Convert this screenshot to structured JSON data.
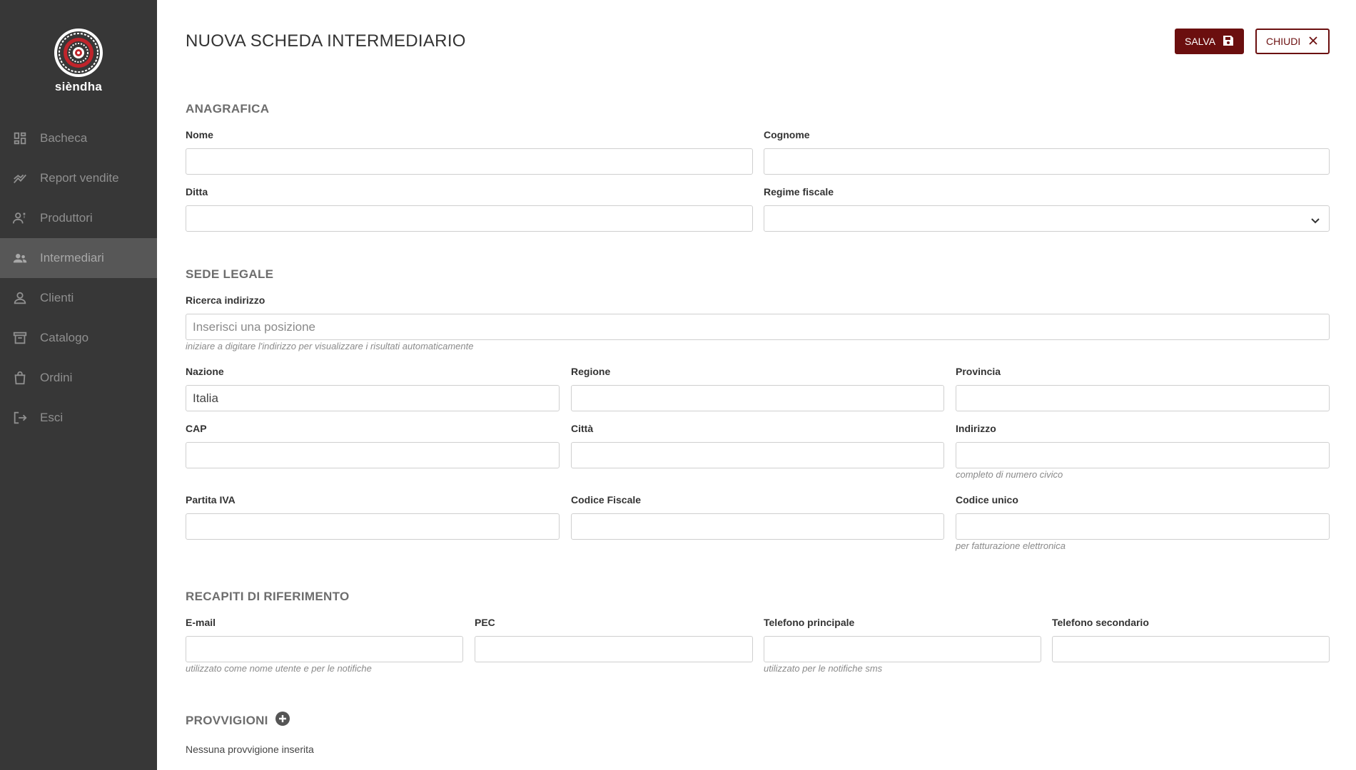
{
  "sidebar": {
    "logo_text": "sièndha",
    "items": [
      {
        "label": "Bacheca",
        "icon": "dashboard-icon",
        "active": false
      },
      {
        "label": "Report vendite",
        "icon": "chart-icon",
        "active": false
      },
      {
        "label": "Produttori",
        "icon": "producers-icon",
        "active": false
      },
      {
        "label": "Intermediari",
        "icon": "intermediaries-icon",
        "active": true
      },
      {
        "label": "Clienti",
        "icon": "person-icon",
        "active": false
      },
      {
        "label": "Catalogo",
        "icon": "archive-icon",
        "active": false
      },
      {
        "label": "Ordini",
        "icon": "bag-icon",
        "active": false
      },
      {
        "label": "Esci",
        "icon": "logout-icon",
        "active": false
      }
    ]
  },
  "header": {
    "title": "NUOVA SCHEDA INTERMEDIARIO",
    "save_label": "SALVA",
    "close_label": "CHIUDI"
  },
  "anagrafica": {
    "title": "ANAGRAFICA",
    "nome_label": "Nome",
    "cognome_label": "Cognome",
    "ditta_label": "Ditta",
    "regime_label": "Regime fiscale"
  },
  "sede": {
    "title": "SEDE LEGALE",
    "ricerca_label": "Ricerca indirizzo",
    "ricerca_placeholder": "Inserisci una posizione",
    "ricerca_hint": "iniziare a digitare l'indirizzo per visualizzare i risultati automaticamente",
    "nazione_label": "Nazione",
    "nazione_value": "Italia",
    "regione_label": "Regione",
    "provincia_label": "Provincia",
    "cap_label": "CAP",
    "citta_label": "Città",
    "indirizzo_label": "Indirizzo",
    "indirizzo_hint": "completo di numero civico",
    "piva_label": "Partita IVA",
    "cf_label": "Codice Fiscale",
    "codice_unico_label": "Codice unico",
    "codice_unico_hint": "per fatturazione elettronica"
  },
  "recapiti": {
    "title": "RECAPITI DI RIFERIMENTO",
    "email_label": "E-mail",
    "email_hint": "utilizzato come nome utente e per le notifiche",
    "pec_label": "PEC",
    "tel1_label": "Telefono principale",
    "tel1_hint": "utilizzato per le notifiche sms",
    "tel2_label": "Telefono secondario"
  },
  "provvigioni": {
    "title": "PROVVIGIONI",
    "empty_text": "Nessuna provvigione inserita"
  },
  "colors": {
    "sidebar_bg": "#373737",
    "sidebar_active": "#575757",
    "accent": "#6b0f0f",
    "logo_red": "#c0242b"
  }
}
